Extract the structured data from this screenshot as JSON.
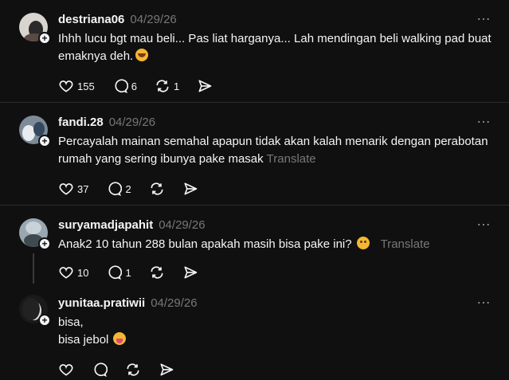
{
  "posts": [
    {
      "username": "destriana06",
      "date": "04/29/26",
      "text": "Ihhh lucu bgt mau beli... Pas liat harganya... Lah mendingan beli walking pad buat emaknya deh.",
      "emoji": "rofl-emoji",
      "translate": "",
      "likes": "155",
      "replies": "6",
      "reposts": "1"
    },
    {
      "username": "fandi.28",
      "date": "04/29/26",
      "text": "Percayalah mainan semahal apapun tidak akan kalah menarik dengan perabotan rumah yang sering ibunya pake masak",
      "translate": "Translate",
      "likes": "37",
      "replies": "2",
      "reposts": ""
    },
    {
      "username": "suryamadjapahit",
      "date": "04/29/26",
      "text": "Anak2 10 tahun 288 bulan apakah masih bisa pake ini?",
      "emoji": "flushed-emoji",
      "translate": "Translate",
      "likes": "10",
      "replies": "1",
      "reposts": ""
    },
    {
      "username": "yunitaa.pratiwii",
      "date": "04/29/26",
      "line1": "bisa,",
      "line2": "bisa jebol",
      "emoji": "tongue-emoji",
      "likes": "",
      "replies": "",
      "reposts": ""
    }
  ],
  "more_icon": "…",
  "plus_icon": "+"
}
